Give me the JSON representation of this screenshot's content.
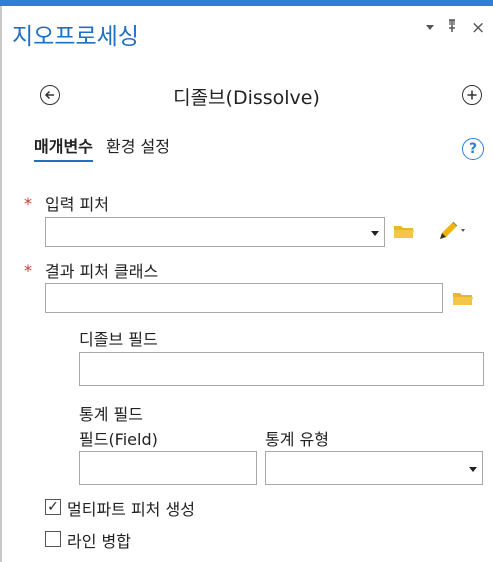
{
  "pane": {
    "title": "지오프로세싱",
    "controls": {
      "menu": "▾",
      "pin": "ᵖ",
      "close": "×"
    }
  },
  "tool": {
    "title": "디졸브(Dissolve)",
    "back_icon": "←",
    "add_icon": "+"
  },
  "tabs": [
    {
      "label": "매개변수",
      "active": true
    },
    {
      "label": "환경 설정",
      "active": false
    }
  ],
  "help_icon": "?",
  "params": {
    "input": {
      "label": "입력 피처",
      "required_mark": "*",
      "value": ""
    },
    "output": {
      "label": "결과 피처 클래스",
      "required_mark": "*",
      "value": ""
    },
    "dissolve_field": {
      "label": "디졸브 필드",
      "value": ""
    },
    "statistics": {
      "label": "통계 필드",
      "field_header": "필드(Field)",
      "type_header": "통계 유형",
      "field_value": "",
      "type_value": ""
    },
    "multipart": {
      "label": "멀티파트 피처 생성",
      "checked": true,
      "mark": "✓"
    },
    "unsplit": {
      "label": "라인 병합",
      "checked": false
    }
  },
  "colors": {
    "accent": "#2c7fd6",
    "title": "#1f6fc5",
    "required": "#c23a2a",
    "folder": "#e8b631",
    "pencil": "#f0b400"
  }
}
